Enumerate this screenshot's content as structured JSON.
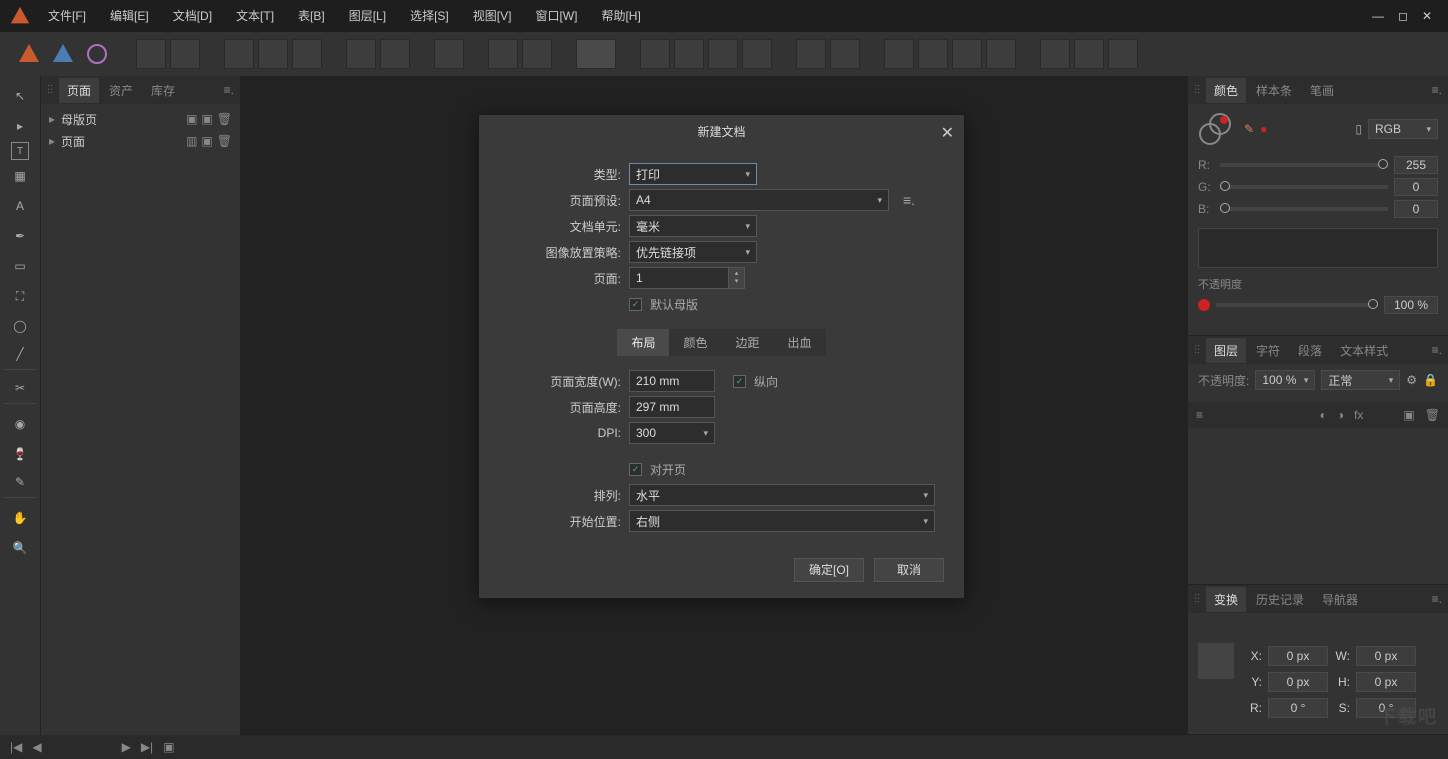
{
  "menu": [
    "文件[F]",
    "编辑[E]",
    "文档[D]",
    "文本[T]",
    "表[B]",
    "图层[L]",
    "选择[S]",
    "视图[V]",
    "窗口[W]",
    "帮助[H]"
  ],
  "leftPanel": {
    "tabs": [
      "页面",
      "资产",
      "库存"
    ],
    "tree": {
      "master": "母版页",
      "page": "页面"
    }
  },
  "colorPanel": {
    "tabs": [
      "颜色",
      "样本条",
      "笔画"
    ],
    "mode": "RGB",
    "r": {
      "label": "R:",
      "value": "255"
    },
    "g": {
      "label": "G:",
      "value": "0"
    },
    "b": {
      "label": "B:",
      "value": "0"
    },
    "opacityLabel": "不透明度",
    "opacityValue": "100 %"
  },
  "layerPanel": {
    "tabs": [
      "图层",
      "字符",
      "段落",
      "文本样式"
    ],
    "opacityLabel": "不透明度:",
    "opacityValue": "100 %",
    "blendMode": "正常"
  },
  "transformPanel": {
    "tabs": [
      "变换",
      "历史记录",
      "导航器"
    ],
    "x": {
      "label": "X:",
      "value": "0 px"
    },
    "y": {
      "label": "Y:",
      "value": "0 px"
    },
    "w": {
      "label": "W:",
      "value": "0 px"
    },
    "h": {
      "label": "H:",
      "value": "0 px"
    },
    "r": {
      "label": "R:",
      "value": "0 °"
    },
    "s": {
      "label": "S:",
      "value": "0 °"
    }
  },
  "dialog": {
    "title": "新建文档",
    "type": {
      "label": "类型:",
      "value": "打印"
    },
    "preset": {
      "label": "页面预设:",
      "value": "A4"
    },
    "units": {
      "label": "文档单元:",
      "value": "毫米"
    },
    "placement": {
      "label": "图像放置策略:",
      "value": "优先链接项"
    },
    "pages": {
      "label": "页面:",
      "value": "1"
    },
    "defaultMaster": "默认母版",
    "tabs": [
      "布局",
      "颜色",
      "边距",
      "出血"
    ],
    "pageW": {
      "label": "页面宽度(W):",
      "value": "210 mm"
    },
    "pageH": {
      "label": "页面高度:",
      "value": "297 mm"
    },
    "portrait": "纵向",
    "dpi": {
      "label": "DPI:",
      "value": "300"
    },
    "facing": "对开页",
    "arrange": {
      "label": "排列:",
      "value": "水平"
    },
    "start": {
      "label": "开始位置:",
      "value": "右侧"
    },
    "ok": "确定[O]",
    "cancel": "取消"
  },
  "watermark": "下载吧"
}
